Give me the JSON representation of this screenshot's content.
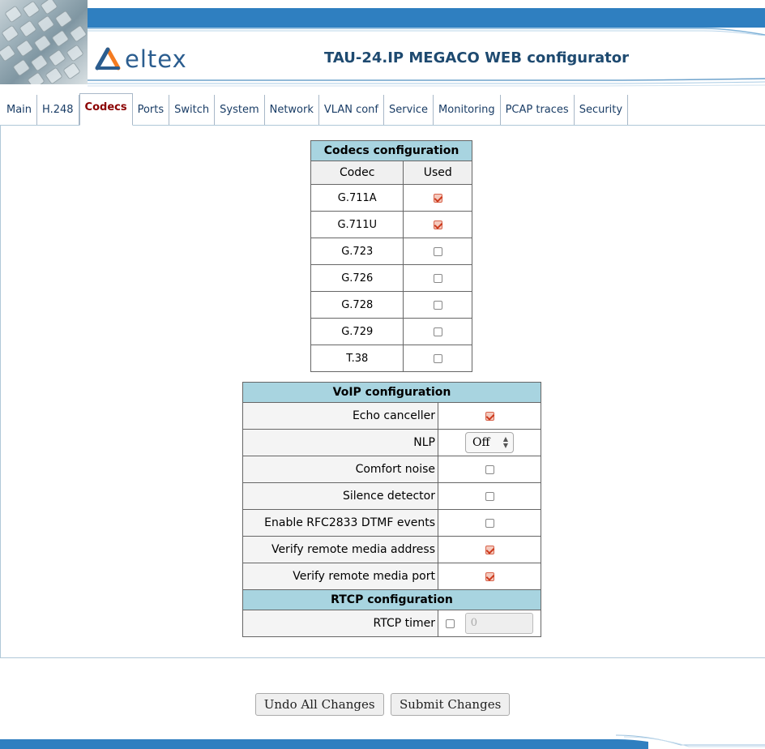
{
  "header": {
    "logo_text": "eltex",
    "app_title": "TAU-24.IP MEGACO WEB configurator"
  },
  "tabs": [
    {
      "label": "Main",
      "active": false
    },
    {
      "label": "H.248",
      "active": false
    },
    {
      "label": "Codecs",
      "active": true
    },
    {
      "label": "Ports",
      "active": false
    },
    {
      "label": "Switch",
      "active": false
    },
    {
      "label": "System",
      "active": false
    },
    {
      "label": "Network",
      "active": false
    },
    {
      "label": "VLAN conf",
      "active": false
    },
    {
      "label": "Service",
      "active": false
    },
    {
      "label": "Monitoring",
      "active": false
    },
    {
      "label": "PCAP traces",
      "active": false
    },
    {
      "label": "Security",
      "active": false
    }
  ],
  "codecs": {
    "title": "Codecs configuration",
    "col_codec": "Codec",
    "col_used": "Used",
    "rows": [
      {
        "name": "G.711A",
        "used": true
      },
      {
        "name": "G.711U",
        "used": true
      },
      {
        "name": "G.723",
        "used": false
      },
      {
        "name": "G.726",
        "used": false
      },
      {
        "name": "G.728",
        "used": false
      },
      {
        "name": "G.729",
        "used": false
      },
      {
        "name": "T.38",
        "used": false
      }
    ]
  },
  "voip": {
    "title": "VoIP configuration",
    "echo_canceller": {
      "label": "Echo canceller",
      "checked": true
    },
    "nlp": {
      "label": "NLP",
      "value": "Off"
    },
    "comfort_noise": {
      "label": "Comfort noise",
      "checked": false
    },
    "silence_detector": {
      "label": "Silence detector",
      "checked": false
    },
    "rfc2833": {
      "label": "Enable RFC2833 DTMF events",
      "checked": false
    },
    "verify_addr": {
      "label": "Verify remote media address",
      "checked": true
    },
    "verify_port": {
      "label": "Verify remote media port",
      "checked": true
    }
  },
  "rtcp": {
    "title": "RTCP configuration",
    "timer": {
      "label": "RTCP timer",
      "checked": false,
      "value": "0"
    }
  },
  "buttons": {
    "undo": "Undo All Changes",
    "submit": "Submit Changes"
  },
  "colors": {
    "header_bar": "#2f7fc0",
    "section_header": "#a8d4e0",
    "active_tab": "#8b0000",
    "tab_text": "#1a3d66"
  }
}
